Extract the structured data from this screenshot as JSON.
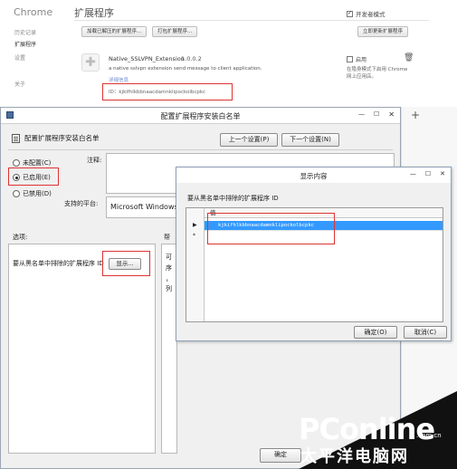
{
  "chrome": {
    "brand": "Chrome",
    "page_title": "扩展程序",
    "developer_mode_label": "开发者模式",
    "developer_mode_checked": true,
    "nav": [
      "历史记录",
      "扩展程序",
      "设置",
      "关于"
    ],
    "buttons": {
      "load_unpacked": "加载已解压的扩展程序...",
      "pack": "打包扩展程序...",
      "update": "立即更新扩展程序"
    },
    "extension": {
      "name": "Native_SSLVPN_Extension",
      "version": "1.0.0.2",
      "description": "a native sslvpn extension send message to client application.",
      "details_link": "详细信息",
      "id_text": "ID：kjkifhlkbbnaacdamnklipockolbcpkc",
      "enable_label": "启用",
      "incognito_text": "在隐身模式下启用 Chrome 网上应用店。"
    }
  },
  "policy": {
    "window_title": "配置扩展程序安装白名单",
    "header": "配置扩展程序安装白名单",
    "prev_button": "上一个设置(P)",
    "next_button": "下一个设置(N)",
    "radios": [
      {
        "label": "未配置(C)",
        "checked": false
      },
      {
        "label": "已启用(E)",
        "checked": true
      },
      {
        "label": "已禁用(D)",
        "checked": false
      }
    ],
    "comment_label": "注释:",
    "platform_label": "支持的平台:",
    "platform_value": "Microsoft Windows",
    "options_label": "选项:",
    "help_label": "帮",
    "option_text": "要从黑名单中排除的扩展程序 ID",
    "show_button": "显示...",
    "side_text": [
      "可",
      "序",
      "，",
      "列"
    ],
    "ok_button": "确定"
  },
  "dialog": {
    "title": "显示内容",
    "caption": "要从黑名单中排除的扩展程序 ID",
    "column_header": "值",
    "row_value": "kjkifhlkbbnaacdamnklipockolbcpkc",
    "ok_button": "确定(O)",
    "cancel_button": "取消(C)"
  },
  "watermark": {
    "brand": "PConline",
    "suffix": ".com.cn",
    "tagline": "太平洋电脑网"
  }
}
